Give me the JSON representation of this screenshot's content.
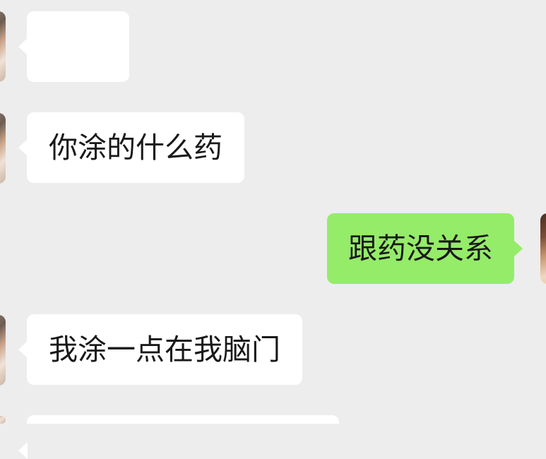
{
  "chat": {
    "messages": [
      {
        "direction": "incoming",
        "text": ""
      },
      {
        "direction": "incoming",
        "text": "你涂的什么药"
      },
      {
        "direction": "outgoing",
        "text": "跟药没关系"
      },
      {
        "direction": "incoming",
        "text": "我涂一点在我脑门"
      },
      {
        "direction": "incoming",
        "text": ""
      }
    ]
  },
  "colors": {
    "background": "#ededed",
    "incoming_bubble": "#ffffff",
    "outgoing_bubble": "#95ec69",
    "text": "#191919"
  }
}
